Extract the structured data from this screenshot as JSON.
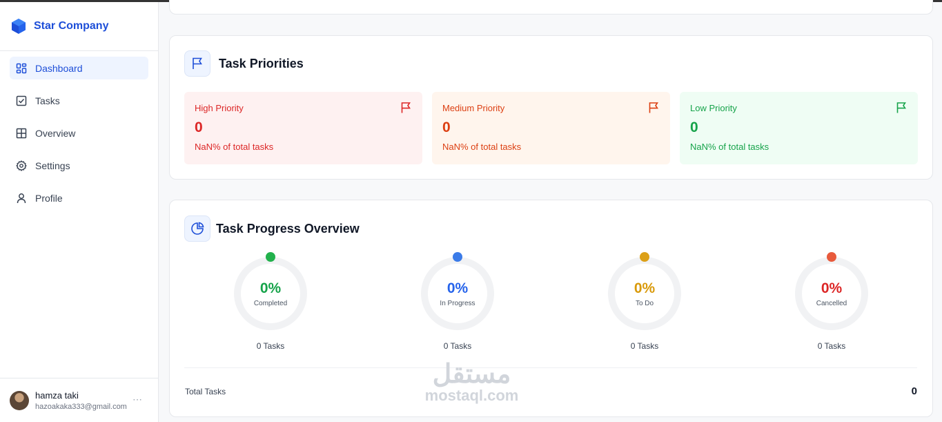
{
  "brand": {
    "name": "Star Company"
  },
  "nav": [
    {
      "label": "Dashboard",
      "icon": "dashboard-icon",
      "active": true
    },
    {
      "label": "Tasks",
      "icon": "checkbox-icon"
    },
    {
      "label": "Overview",
      "icon": "grid-icon"
    },
    {
      "label": "Settings",
      "icon": "gear-icon"
    },
    {
      "label": "Profile",
      "icon": "user-icon"
    }
  ],
  "user": {
    "name": "hamza taki",
    "email": "hazoakaka333@gmail.com",
    "more": "⋯"
  },
  "priorities": {
    "title": "Task Priorities",
    "items": [
      {
        "label": "High Priority",
        "value": "0",
        "sub": "NaN% of total tasks",
        "color": "#dc2626",
        "bg": "#fef1f1"
      },
      {
        "label": "Medium Priority",
        "value": "0",
        "sub": "NaN% of total tasks",
        "color": "#dc3f12",
        "bg": "#fff5ed"
      },
      {
        "label": "Low Priority",
        "value": "0",
        "sub": "NaN% of total tasks",
        "color": "#16a34a",
        "bg": "#effdf4"
      }
    ]
  },
  "progress": {
    "title": "Task Progress Overview",
    "items": [
      {
        "pct": "0%",
        "label": "Completed",
        "tasks": "0 Tasks",
        "color": "#16a34a",
        "dot": "#22b14c"
      },
      {
        "pct": "0%",
        "label": "In Progress",
        "tasks": "0 Tasks",
        "color": "#2563eb",
        "dot": "#3b7be8"
      },
      {
        "pct": "0%",
        "label": "To Do",
        "tasks": "0 Tasks",
        "color": "#d99a0b",
        "dot": "#dca018"
      },
      {
        "pct": "0%",
        "label": "Cancelled",
        "tasks": "0 Tasks",
        "color": "#dc2626",
        "dot": "#e85a3c"
      }
    ],
    "total_label": "Total Tasks",
    "total_value": "0"
  },
  "watermark": {
    "arabic": "مستقل",
    "latin": "mostaql.com"
  }
}
